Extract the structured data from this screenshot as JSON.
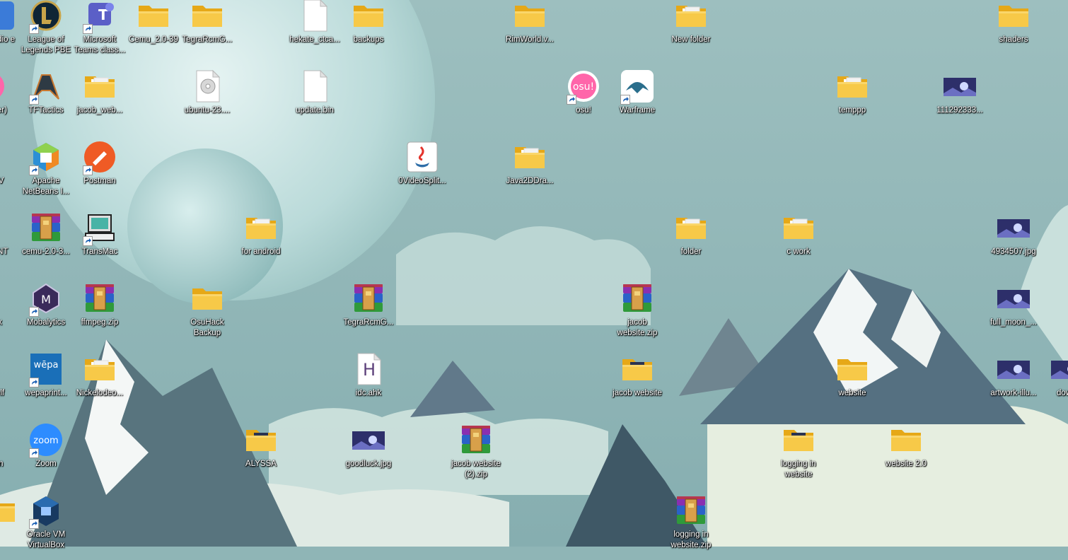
{
  "desktop": {
    "icons": [
      {
        "label": "Studio e",
        "type": "app-studio",
        "shortcut": false
      },
      {
        "label": "League of Legends PBE",
        "type": "app-lol",
        "shortcut": true
      },
      {
        "label": "Microsoft Teams class...",
        "type": "app-teams",
        "shortcut": true
      },
      {
        "label": "Cemu_2.0-39",
        "type": "folder",
        "shortcut": false
      },
      {
        "label": "TegraRcmG...",
        "type": "folder",
        "shortcut": false
      },
      {
        "label": "hekate_ctca...",
        "type": "file",
        "shortcut": false
      },
      {
        "label": "backups",
        "type": "folder",
        "shortcut": false
      },
      {
        "label": "RimWorld.v...",
        "type": "folder",
        "shortcut": false
      },
      {
        "label": "New folder",
        "type": "folder-files",
        "shortcut": false
      },
      {
        "label": "shaders",
        "type": "folder",
        "shortcut": false
      },
      {
        "label": "zer)",
        "type": "app-pink",
        "shortcut": false
      },
      {
        "label": "TFTactics",
        "type": "app-tft",
        "shortcut": true
      },
      {
        "label": "jacob_web...",
        "type": "folder-files",
        "shortcut": false
      },
      {
        "label": "ubuntu-23....",
        "type": "disc-image",
        "shortcut": false
      },
      {
        "label": "update.bin",
        "type": "file",
        "shortcut": false
      },
      {
        "label": "osu!",
        "type": "app-osu",
        "shortcut": true
      },
      {
        "label": "Warframe",
        "type": "app-warframe",
        "shortcut": true
      },
      {
        "label": "temppp",
        "type": "folder-files",
        "shortcut": false
      },
      {
        "label": "111292333...",
        "type": "image-thumb",
        "shortcut": false
      },
      {
        "label": "IV",
        "type": "app-red",
        "shortcut": false
      },
      {
        "label": "Apache NetBeans I...",
        "type": "app-netbeans",
        "shortcut": true
      },
      {
        "label": "Postman",
        "type": "app-postman",
        "shortcut": true
      },
      {
        "label": "0VideoSplit...",
        "type": "app-java",
        "shortcut": false
      },
      {
        "label": "Java2DDra...",
        "type": "folder-files",
        "shortcut": false
      },
      {
        "label": "ANT",
        "type": "app-dark",
        "shortcut": false
      },
      {
        "label": "cemu-2.0-3...",
        "type": "archive",
        "shortcut": false
      },
      {
        "label": "TransMac",
        "type": "app-transmac",
        "shortcut": true
      },
      {
        "label": "for android",
        "type": "folder-files",
        "shortcut": false
      },
      {
        "label": "folder",
        "type": "folder-files",
        "shortcut": false
      },
      {
        "label": "c work",
        "type": "folder-files",
        "shortcut": false
      },
      {
        "label": "4934507.jpg",
        "type": "image-thumb",
        "shortcut": false
      },
      {
        "label": "x",
        "type": "app-firefox",
        "shortcut": false
      },
      {
        "label": "Mobalytics",
        "type": "app-mobalytics",
        "shortcut": true
      },
      {
        "label": "ffmpeg.zip",
        "type": "archive",
        "shortcut": false
      },
      {
        "label": "OsuHack Backup",
        "type": "folder",
        "shortcut": false
      },
      {
        "label": "TegraRcmG...",
        "type": "archive",
        "shortcut": false
      },
      {
        "label": "jacob website.zip",
        "type": "archive",
        "shortcut": false
      },
      {
        "label": "full_moon_...",
        "type": "image-thumb",
        "shortcut": false
      },
      {
        "label": "olf",
        "type": "app-black",
        "shortcut": false
      },
      {
        "label": "wepaprint...",
        "type": "app-wepa",
        "shortcut": true
      },
      {
        "label": "Nickelodeo...",
        "type": "folder-files",
        "shortcut": false
      },
      {
        "label": "idc.ahk",
        "type": "ahk",
        "shortcut": false
      },
      {
        "label": "jacob website",
        "type": "folder-photo",
        "shortcut": false
      },
      {
        "label": "website",
        "type": "folder",
        "shortcut": false
      },
      {
        "label": "artwork-illu...",
        "type": "image-thumb",
        "shortcut": false
      },
      {
        "label": "downl",
        "type": "image-thumb",
        "shortcut": false
      },
      {
        "label": "in",
        "type": "app-blue",
        "shortcut": false
      },
      {
        "label": "Zoom",
        "type": "app-zoom",
        "shortcut": true
      },
      {
        "label": "ALYSSA",
        "type": "folder-photo",
        "shortcut": false
      },
      {
        "label": "goodluck.jpg",
        "type": "image-thumb",
        "shortcut": false
      },
      {
        "label": "jacob website (2).zip",
        "type": "archive",
        "shortcut": false
      },
      {
        "label": "logging in website",
        "type": "folder-photo",
        "shortcut": false
      },
      {
        "label": "website 2.0",
        "type": "folder",
        "shortcut": false
      },
      {
        "label": "",
        "type": "folder",
        "shortcut": false
      },
      {
        "label": "Oracle VM VirtualBox",
        "type": "app-virtualbox",
        "shortcut": true
      },
      {
        "label": "logging in website.zip",
        "type": "archive",
        "shortcut": false
      }
    ]
  },
  "colors": {
    "sky": "#8fb5b6",
    "moon": "#d6ecec",
    "folder": "#f7c948",
    "folder_back": "#e6a817",
    "label_text": "#ffffff"
  }
}
